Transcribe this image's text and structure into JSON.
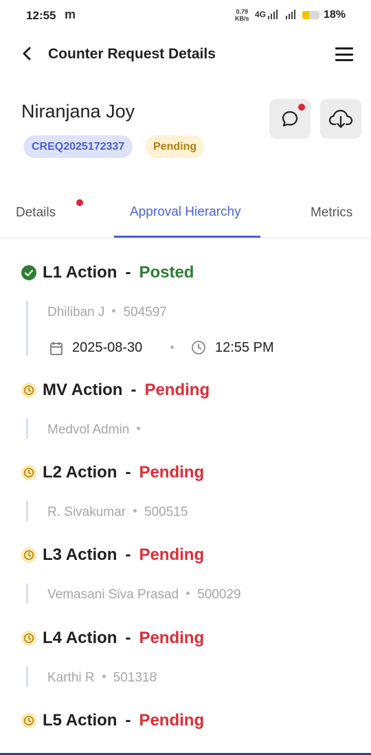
{
  "status_bar": {
    "time": "12:55",
    "app_letter": "m",
    "speed_value": "0.79",
    "speed_unit": "KB/s",
    "network": "4G",
    "battery_pct": "18%",
    "battery_level": 0.18
  },
  "header": {
    "title": "Counter Request Details"
  },
  "request": {
    "name": "Niranjana Joy",
    "id": "CREQ2025172337",
    "status": "Pending"
  },
  "actions": {
    "chat_icon": "chat-bubble-icon",
    "download_icon": "cloud-download-icon"
  },
  "tabs": [
    {
      "label": "Details"
    },
    {
      "label": "Approval Hierarchy"
    },
    {
      "label": "Metrics"
    }
  ],
  "stages": [
    {
      "title": "L1 Action",
      "sep": "-",
      "status": "Posted",
      "person": "Dhiliban J",
      "code": "504597",
      "date": "2025-08-30",
      "time": "12:55 PM"
    },
    {
      "title": "MV Action",
      "sep": "-",
      "status": "Pending",
      "person": "Medvol Admin",
      "code": ""
    },
    {
      "title": "L2 Action",
      "sep": "-",
      "status": "Pending",
      "person": "R. Sivakumar",
      "code": "500515"
    },
    {
      "title": "L3 Action",
      "sep": "-",
      "status": "Pending",
      "person": "Vemasani Siva Prasad",
      "code": "500029"
    },
    {
      "title": "L4 Action",
      "sep": "-",
      "status": "Pending",
      "person": "Karthi R",
      "code": "501318"
    },
    {
      "title": "L5 Action",
      "sep": "-",
      "status": "Pending"
    }
  ],
  "colors": {
    "accent": "#4b63d6",
    "posted": "#2e7d32",
    "pending": "#e02c36",
    "badge_id_bg": "#dde3fb",
    "badge_status_bg": "#fdf2d4"
  }
}
